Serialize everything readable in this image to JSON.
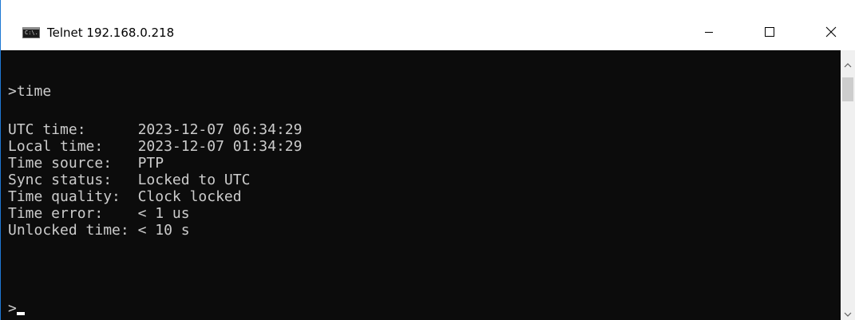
{
  "window": {
    "title": "Telnet 192.168.0.218",
    "icon": "console-app-icon",
    "icon_label": "C:\\."
  },
  "controls": {
    "minimize_icon": "minimize-icon",
    "maximize_icon": "maximize-icon",
    "close_icon": "close-icon"
  },
  "console": {
    "command": ">time",
    "fields": [
      {
        "label": "UTC time:      ",
        "value": "2023-12-07 06:34:29"
      },
      {
        "label": "Local time:    ",
        "value": "2023-12-07 01:34:29"
      },
      {
        "label": "Time source:   ",
        "value": "PTP"
      },
      {
        "label": "Sync status:   ",
        "value": "Locked to UTC"
      },
      {
        "label": "Time quality:  ",
        "value": "Clock locked"
      },
      {
        "label": "Time error:    ",
        "value": "< 1 us"
      },
      {
        "label": "Unlocked time: ",
        "value": "< 10 s"
      }
    ],
    "prompt": ">"
  },
  "colors": {
    "console_bg": "#0c0c0c",
    "console_text": "#cccccc",
    "titlebar_bg": "#ffffff",
    "scrollbar_bg": "#f0f0f0"
  }
}
